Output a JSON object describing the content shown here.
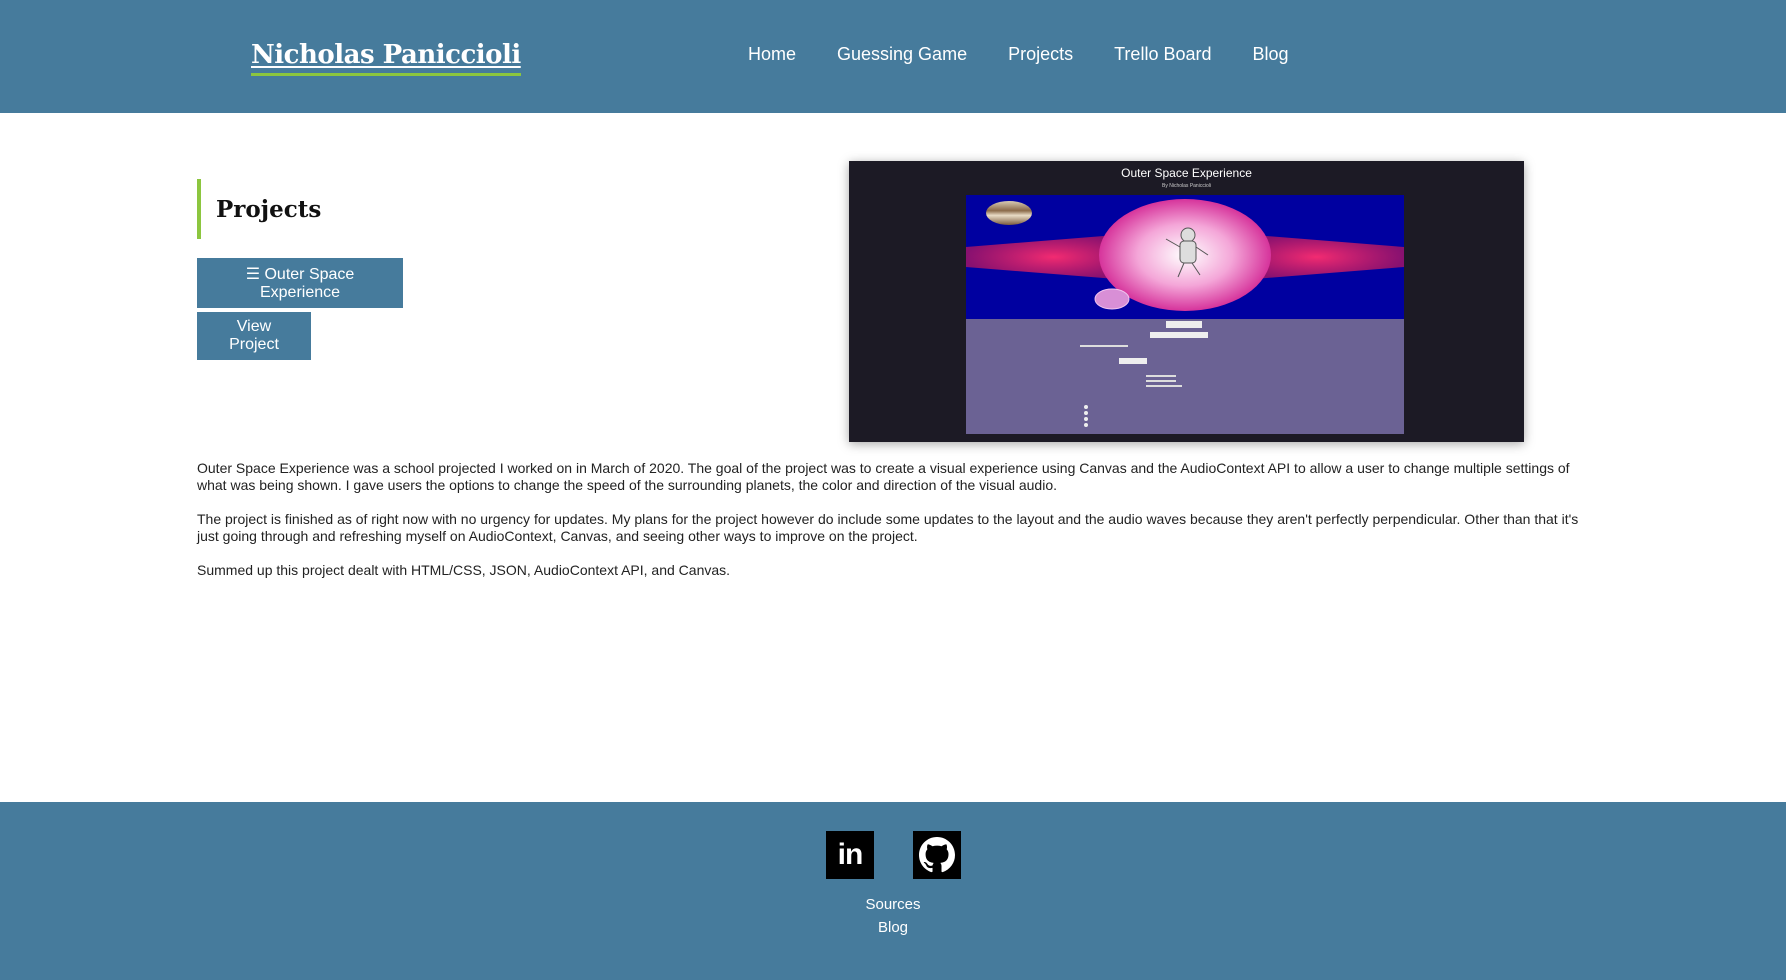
{
  "header": {
    "site_title": "Nicholas Paniccioli",
    "nav": [
      {
        "label": "Home"
      },
      {
        "label": "Guessing Game"
      },
      {
        "label": "Projects"
      },
      {
        "label": "Trello Board"
      },
      {
        "label": "Blog"
      }
    ]
  },
  "main": {
    "heading": "Projects",
    "dropdown_label": "☰ Outer Space Experience",
    "view_button_label": "View Project",
    "screenshot": {
      "title": "Outer Space Experience",
      "subtitle": "By Nicholas Paniccioli",
      "colors": {
        "frame": "#1c1a25",
        "canvas": "#0000a0",
        "controls": "#6b6294",
        "wave": "#c2185b"
      }
    },
    "description": [
      "Outer Space Experience was a school projected I worked on in March of 2020. The goal of the project was to create a visual experience using Canvas and the AudioContext API to allow a user to change multiple settings of what was being shown. I gave users the options to change the speed of the surrounding planets, the color and direction of the visual audio.",
      "The project is finished as of right now with no urgency for updates. My plans for the project however do include some updates to the layout and the audio waves because they aren't perfectly perpendicular. Other than that it's just going through and refreshing myself on AudioContext, Canvas, and seeing other ways to improve on the project.",
      "Summed up this project dealt with HTML/CSS, JSON, AudioContext API, and Canvas."
    ]
  },
  "footer": {
    "social": [
      {
        "icon": "linkedin-icon",
        "glyph": "in"
      },
      {
        "icon": "github-icon"
      }
    ],
    "sources_label": "Sources",
    "blog_label": "Blog"
  },
  "colors": {
    "brand": "#467b9c",
    "accent": "#8cc63f"
  }
}
